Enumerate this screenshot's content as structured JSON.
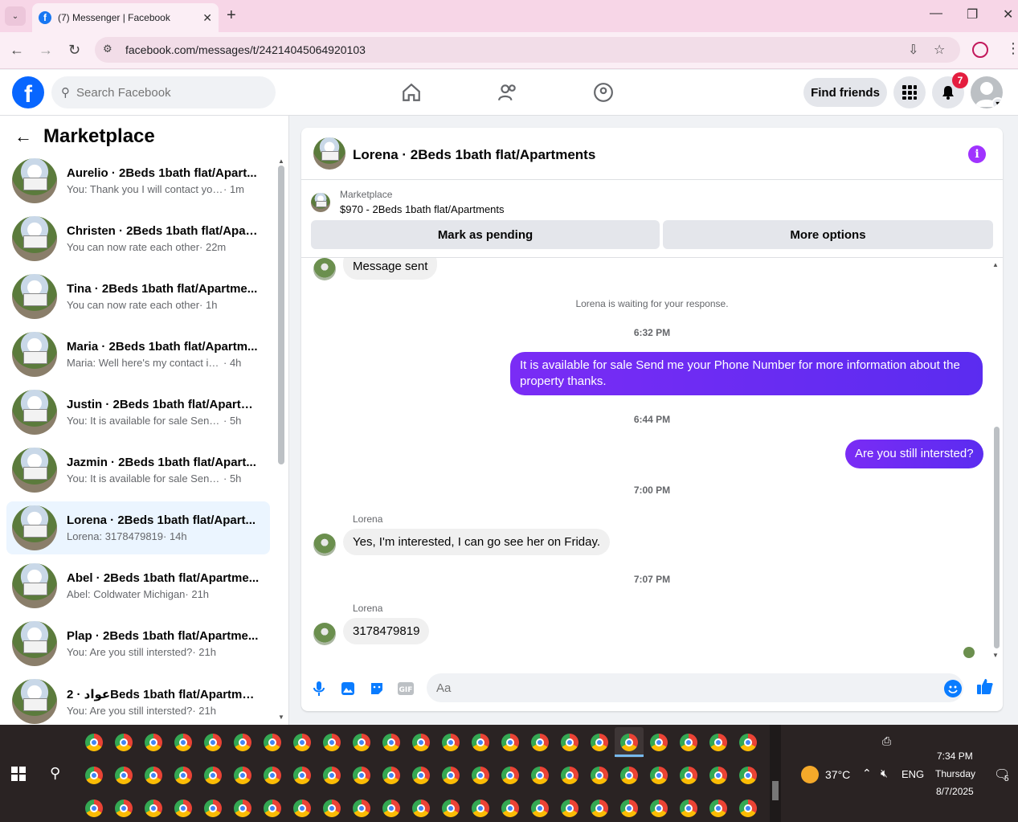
{
  "browser": {
    "tab_title": "(7) Messenger | Facebook",
    "tab_close": "✕",
    "new_tab": "+",
    "tab_dropdown": "⌄",
    "url": "facebook.com/messages/t/24214045064920103",
    "window_controls": {
      "minimize": "—",
      "restore": "❐",
      "close": "✕"
    },
    "nav": {
      "back": "←",
      "forward": "→",
      "reload": "↻"
    }
  },
  "fb_header": {
    "logo": "f",
    "search_placeholder": "Search Facebook",
    "find_friends": "Find friends",
    "notification_count": "7"
  },
  "sidebar": {
    "title": "Marketplace",
    "conversations": [
      {
        "name": "Aurelio · 2Beds 1bath flat/Apart...",
        "snippet": "You: Thank you I will contact you a...",
        "time": " · 1m",
        "active": false
      },
      {
        "name": "Christen · 2Beds 1bath flat/Apart...",
        "snippet": "You can now rate each other",
        "time": " · 22m",
        "active": false
      },
      {
        "name": "Tina · 2Beds 1bath flat/Apartme...",
        "snippet": "You can now rate each other",
        "time": " · 1h",
        "active": false
      },
      {
        "name": "Maria · 2Beds 1bath flat/Apartm...",
        "snippet": "Maria: Well here's my contact infor...",
        "time": " · 4h",
        "active": false
      },
      {
        "name": "Justin · 2Beds 1bath flat/Apartm...",
        "snippet": "You: It is available for sale Send me ...",
        "time": " · 5h",
        "active": false
      },
      {
        "name": "Jazmin · 2Beds 1bath flat/Apart...",
        "snippet": "You: It is available for sale Send me ...",
        "time": " · 5h",
        "active": false
      },
      {
        "name": "Lorena · 2Beds 1bath flat/Apart...",
        "snippet": "Lorena: 3178479819",
        "time": " · 14h",
        "active": true
      },
      {
        "name": "Abel · 2Beds 1bath flat/Apartme...",
        "snippet": "Abel: Coldwater Michigan",
        "time": " · 21h",
        "active": false
      },
      {
        "name": "Plap · 2Beds 1bath flat/Apartme...",
        "snippet": "You: Are you still intersted?",
        "time": " · 21h",
        "active": false
      },
      {
        "name": "عواد · 2Beds 1bath flat/Apartments...",
        "snippet": "You: Are you still intersted?",
        "time": " · 21h",
        "active": false
      }
    ]
  },
  "chat": {
    "title": "Lorena · 2Beds 1bath flat/Apartments",
    "marketplace_label": "Marketplace",
    "listing": "$970 - 2Beds 1bath flat/Apartments",
    "mark_pending": "Mark as pending",
    "more_options": "More options",
    "message_sent": "Message sent",
    "waiting": "Lorena is waiting for your response.",
    "ts1": "6:32 PM",
    "out1": "It is available for sale Send me your Phone Number for more information about the property thanks.",
    "ts2": "6:44 PM",
    "out2": "Are you still intersted?",
    "ts3": "7:00 PM",
    "sender1": "Lorena",
    "in1": "Yes, I'm interested, I can go see her on Friday.",
    "ts4": "7:07 PM",
    "sender2": "Lorena",
    "in2": "3178479819",
    "input_placeholder": "Aa"
  },
  "taskbar": {
    "temperature": "37°C",
    "language": "ENG",
    "time": "7:34 PM",
    "day": "Thursday",
    "date": "8/7/2025",
    "notification_count": "5"
  },
  "colors": {
    "facebook_blue": "#0866ff",
    "messenger_purple": "#6a2cf3",
    "active_row": "#ebf5ff"
  }
}
